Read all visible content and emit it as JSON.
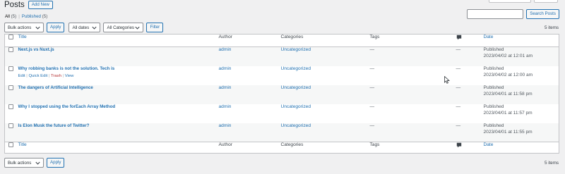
{
  "header": {
    "title": "Posts",
    "add_new_label": "Add New"
  },
  "filters": {
    "all_label": "All",
    "all_count": "(5)",
    "published_label": "Published",
    "published_count": "(5)",
    "separator": "|"
  },
  "search": {
    "button_label": "Search Posts",
    "value": ""
  },
  "tablenav_top": {
    "bulk_actions": "Bulk actions",
    "apply": "Apply",
    "dates": "All dates",
    "categories": "All Categories",
    "filter": "Filter",
    "items_count": "5 items"
  },
  "columns": {
    "title": "Title",
    "author": "Author",
    "categories": "Categories",
    "tags": "Tags",
    "date": "Date"
  },
  "posts": [
    {
      "title": "Next.js vs Nuxt.js",
      "author": "admin",
      "category": "Uncategorized",
      "tags": "—",
      "comments": "—",
      "status": "Published",
      "date": "2023/04/02 at 12:01 am"
    },
    {
      "title": "Why robbing banks is not the solution. Tech is",
      "author": "admin",
      "category": "Uncategorized",
      "tags": "—",
      "comments": "—",
      "status": "Published",
      "date": "2023/04/02 at 12:00 am"
    },
    {
      "title": "The dangers of Artificial Intelligence",
      "author": "admin",
      "category": "Uncategorized",
      "tags": "—",
      "comments": "—",
      "status": "Published",
      "date": "2023/04/01 at 11:58 pm"
    },
    {
      "title": "Why I stopped using the forEach Array Method",
      "author": "admin",
      "category": "Uncategorized",
      "tags": "—",
      "comments": "—",
      "status": "Published",
      "date": "2023/04/01 at 11:57 pm"
    },
    {
      "title": "Is Elon Musk the future of Twitter?",
      "author": "admin",
      "category": "Uncategorized",
      "tags": "—",
      "comments": "—",
      "status": "Published",
      "date": "2023/04/01 at 11:55 pm"
    }
  ],
  "row_actions": {
    "edit": "Edit",
    "quick_edit": "Quick Edit",
    "trash": "Trash",
    "view": "View",
    "sep": "|"
  },
  "tablenav_bottom": {
    "bulk_actions": "Bulk actions",
    "apply": "Apply",
    "items_count": "5 items"
  },
  "colors": {
    "link": "#2271b1",
    "trash": "#b32d2e",
    "background": "#f0f0f1"
  }
}
